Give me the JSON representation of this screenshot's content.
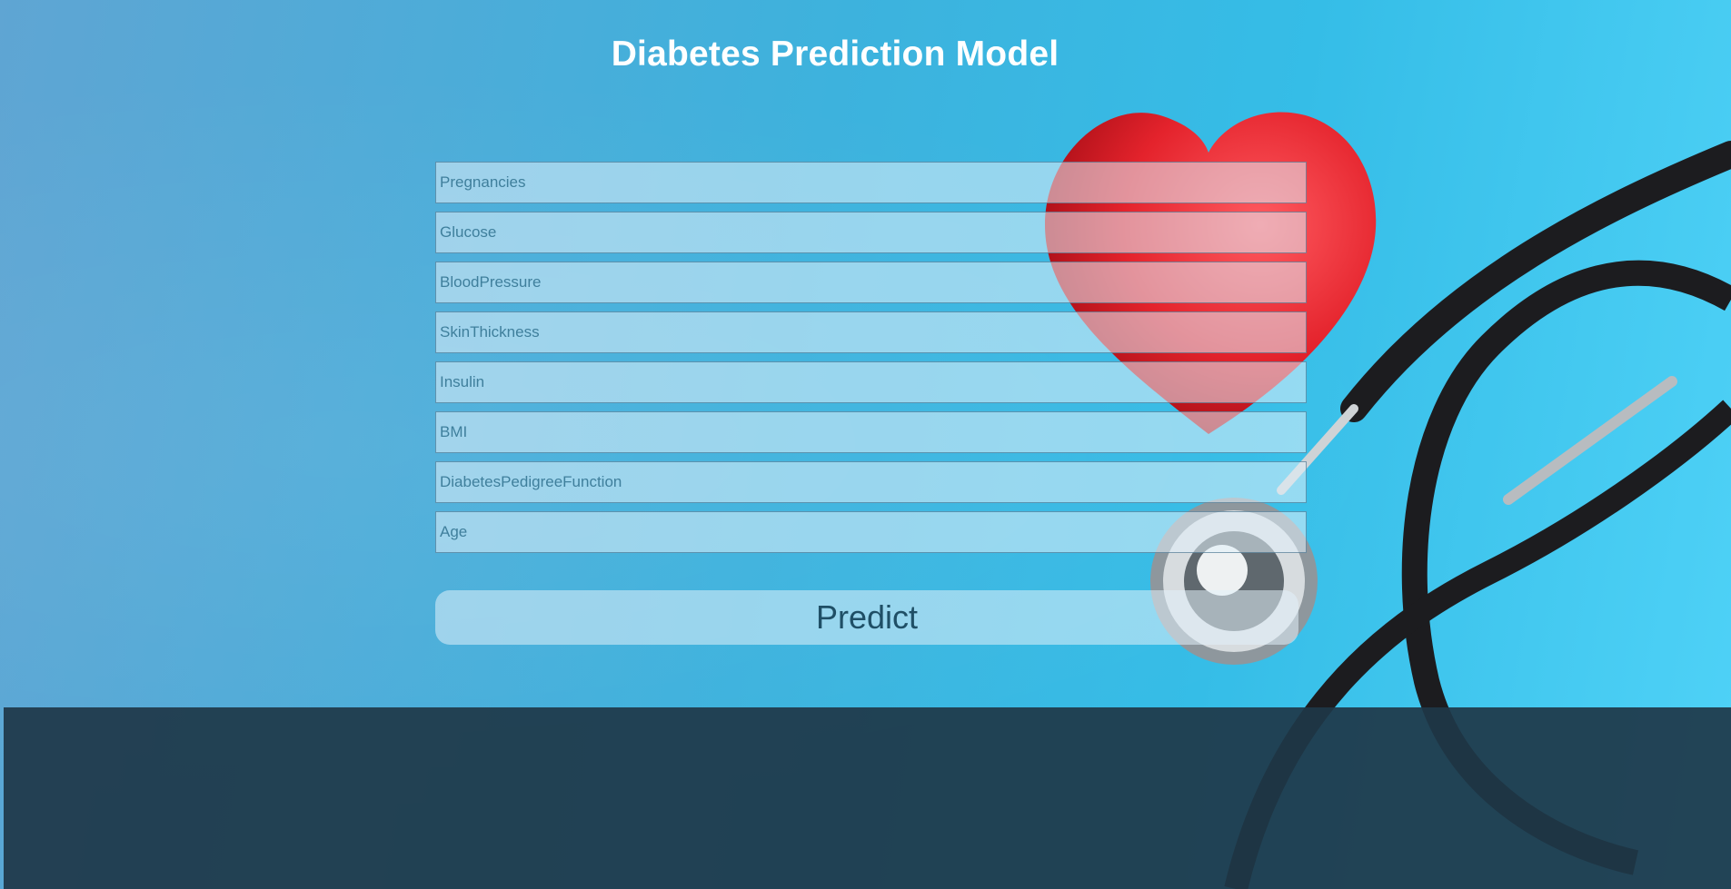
{
  "page": {
    "title": "Diabetes Prediction Model"
  },
  "form": {
    "fields": [
      {
        "placeholder": "Pregnancies",
        "value": ""
      },
      {
        "placeholder": "Glucose",
        "value": ""
      },
      {
        "placeholder": "BloodPressure",
        "value": ""
      },
      {
        "placeholder": "SkinThickness",
        "value": ""
      },
      {
        "placeholder": "Insulin",
        "value": ""
      },
      {
        "placeholder": "BMI",
        "value": ""
      },
      {
        "placeholder": "DiabetesPedigreeFunction",
        "value": ""
      },
      {
        "placeholder": "Age",
        "value": ""
      }
    ],
    "submit_label": "Predict"
  },
  "result": {
    "text": ""
  },
  "icons": {
    "background_decor": [
      "heart-icon",
      "stethoscope-icon"
    ]
  },
  "colors": {
    "title": "#ffffff",
    "heart": "#e4232c",
    "result_panel": "#1e3748"
  }
}
